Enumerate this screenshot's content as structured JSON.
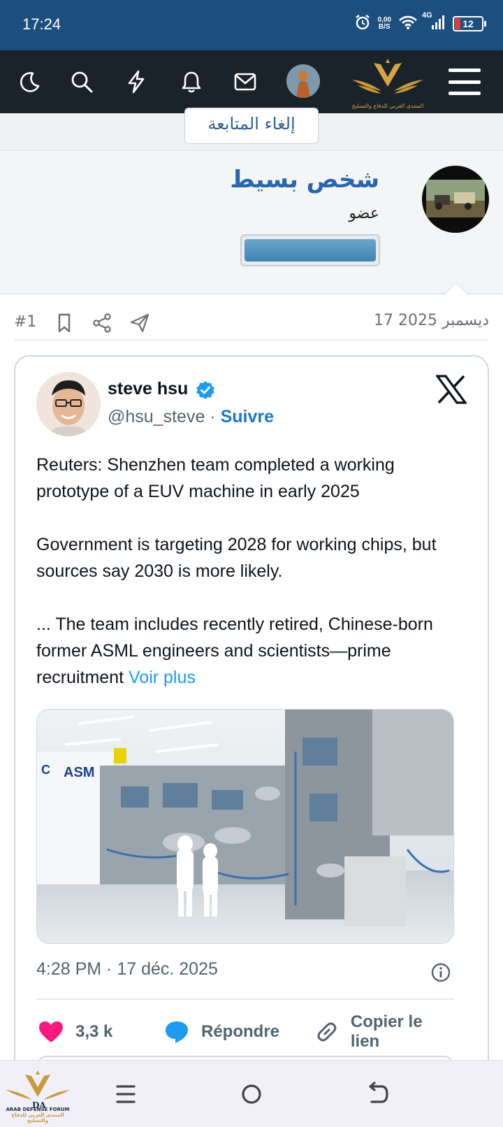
{
  "status_bar": {
    "time": "17:24",
    "net_speed_value": "0,00",
    "net_speed_unit": "B/S",
    "network": "4G",
    "battery": "12",
    "icons": [
      "alarm-icon",
      "wifi-icon",
      "signal-icon",
      "battery-icon"
    ],
    "battery_color": "#e53935"
  },
  "navbar": {
    "background": "#1a222a",
    "icons": [
      "moon-icon",
      "search-icon",
      "bolt-icon",
      "bell-icon",
      "mail-icon",
      "avatar",
      "forum-logo",
      "menu-icon"
    ],
    "logo_text": "المنتدى العربي للدفاع والتسليح"
  },
  "follow": {
    "unfollow_label": "إلغاء المتابعة"
  },
  "user": {
    "name": "شخص بسيط",
    "role": "عضو",
    "name_color": "#2765b0"
  },
  "post": {
    "number": "#1",
    "date": "17 ديسمبر 2025",
    "icons": [
      "bookmark-icon",
      "share-icon",
      "send-icon"
    ]
  },
  "tweet": {
    "author_name": "steve hsu",
    "handle": "@hsu_steve",
    "separator": "·",
    "follow_label": "Suivre",
    "paragraph_1": "Reuters: Shenzhen team completed a working prototype of a EUV machine in early 2025",
    "paragraph_2": "Government is targeting 2028 for working chips, but sources say 2030 is more likely.",
    "paragraph_3": "... The team includes recently retired, Chinese-born former ASML engineers and scientists—prime recruitment",
    "voir_plus": "Voir plus",
    "image_text": "ASM",
    "timestamp": "4:28 PM · 17 déc. 2025",
    "likes": "3,3 k",
    "reply_label": "Répondre",
    "copy_link_label": "Copier le lien",
    "link_color": "#1d9bf0",
    "like_color": "#f91880"
  },
  "bottom_nav": {
    "logo_text": "ARAB DEFENSE FORUM",
    "logo_subtext": "المنتدى العربي للدفاع والتسليح",
    "icons": [
      "recents-icon",
      "home-icon",
      "back-icon"
    ]
  }
}
